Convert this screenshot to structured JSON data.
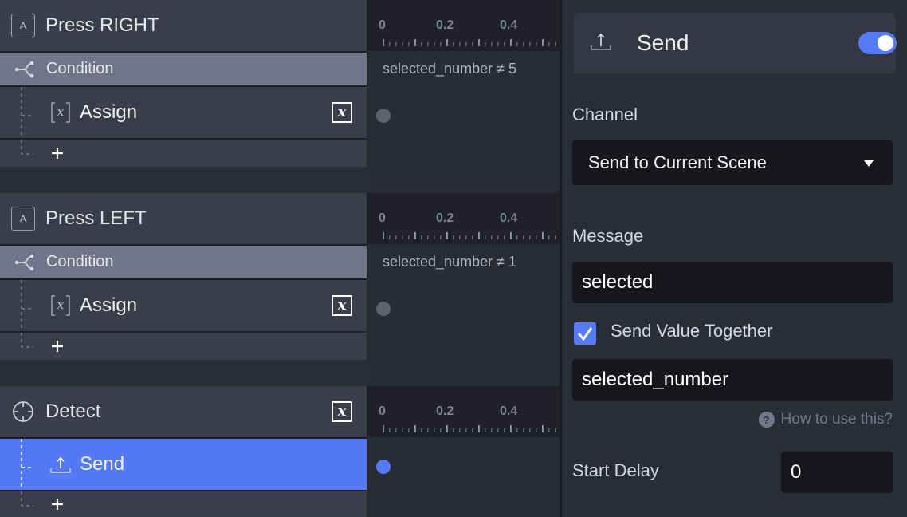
{
  "tree": {
    "groups": [
      {
        "trigger": {
          "label": "Press RIGHT",
          "icon": "key-icon",
          "key_glyph": "A"
        },
        "condition": {
          "label": "Condition",
          "icon": "branch-icon",
          "expression": "selected_number ≠ 5"
        },
        "action": {
          "label": "Assign",
          "icon": "variable-bracket-icon",
          "badge": "x",
          "selected": false
        },
        "add_label": "+"
      },
      {
        "trigger": {
          "label": "Press LEFT",
          "icon": "key-icon",
          "key_glyph": "A"
        },
        "condition": {
          "label": "Condition",
          "icon": "branch-icon",
          "expression": "selected_number ≠ 1"
        },
        "action": {
          "label": "Assign",
          "icon": "variable-bracket-icon",
          "badge": "x",
          "selected": false
        },
        "add_label": "+"
      },
      {
        "trigger": {
          "label": "Detect",
          "icon": "crosshair-icon",
          "badge": "x"
        },
        "action": {
          "label": "Send",
          "icon": "upload-icon",
          "selected": true
        },
        "add_label": "+"
      }
    ]
  },
  "timeline": {
    "ruler_labels": [
      "0",
      "0.2",
      "0.4"
    ]
  },
  "panel": {
    "title": "Send",
    "enabled": true,
    "channel_label": "Channel",
    "channel_value": "Send to Current Scene",
    "message_label": "Message",
    "message_value": "selected",
    "send_value_together_label": "Send Value Together",
    "send_value_together_checked": true,
    "value_field": "selected_number",
    "help_text": "How to use this?",
    "help_glyph": "?",
    "start_delay_label": "Start Delay",
    "start_delay_value": "0"
  },
  "colors": {
    "accent": "#5679f6",
    "condition_row": "#707687",
    "row": "#3a3e4a",
    "background": "#2a2c36"
  }
}
